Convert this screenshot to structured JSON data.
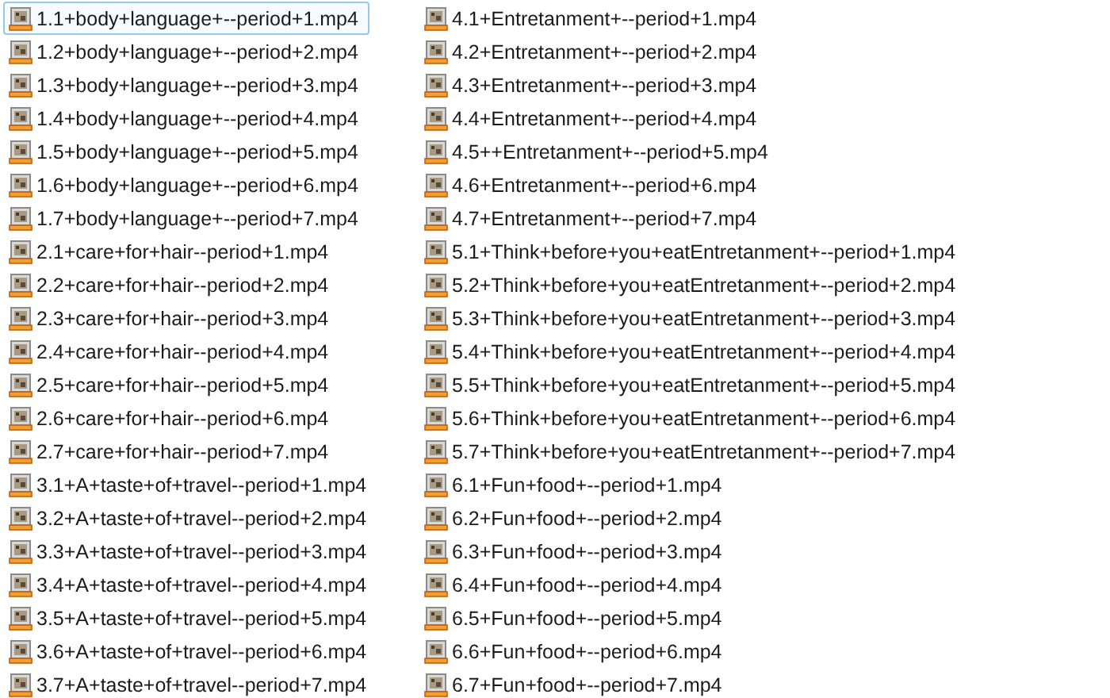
{
  "files": [
    {
      "name": "1.1+body+language+--period+1.mp4",
      "selected": true
    },
    {
      "name": "1.2+body+language+--period+2.mp4",
      "selected": false
    },
    {
      "name": "1.3+body+language+--period+3.mp4",
      "selected": false
    },
    {
      "name": "1.4+body+language+--period+4.mp4",
      "selected": false
    },
    {
      "name": "1.5+body+language+--period+5.mp4",
      "selected": false
    },
    {
      "name": "1.6+body+language+--period+6.mp4",
      "selected": false
    },
    {
      "name": "1.7+body+language+--period+7.mp4",
      "selected": false
    },
    {
      "name": "2.1+care+for+hair--period+1.mp4",
      "selected": false
    },
    {
      "name": "2.2+care+for+hair--period+2.mp4",
      "selected": false
    },
    {
      "name": "2.3+care+for+hair--period+3.mp4",
      "selected": false
    },
    {
      "name": "2.4+care+for+hair--period+4.mp4",
      "selected": false
    },
    {
      "name": "2.5+care+for+hair--period+5.mp4",
      "selected": false
    },
    {
      "name": "2.6+care+for+hair--period+6.mp4",
      "selected": false
    },
    {
      "name": "2.7+care+for+hair--period+7.mp4",
      "selected": false
    },
    {
      "name": "3.1+A+taste+of+travel--period+1.mp4",
      "selected": false
    },
    {
      "name": "3.2+A+taste+of+travel--period+2.mp4",
      "selected": false
    },
    {
      "name": "3.3+A+taste+of+travel--period+3.mp4",
      "selected": false
    },
    {
      "name": "3.4+A+taste+of+travel--period+4.mp4",
      "selected": false
    },
    {
      "name": "3.5+A+taste+of+travel--period+5.mp4",
      "selected": false
    },
    {
      "name": "3.6+A+taste+of+travel--period+6.mp4",
      "selected": false
    },
    {
      "name": "3.7+A+taste+of+travel--period+7.mp4",
      "selected": false
    },
    {
      "name": "4.1+Entretanment+--period+1.mp4",
      "selected": false
    },
    {
      "name": "4.2+Entretanment+--period+2.mp4",
      "selected": false
    },
    {
      "name": "4.3+Entretanment+--period+3.mp4",
      "selected": false
    },
    {
      "name": "4.4+Entretanment+--period+4.mp4",
      "selected": false
    },
    {
      "name": "4.5++Entretanment+--period+5.mp4",
      "selected": false
    },
    {
      "name": "4.6+Entretanment+--period+6.mp4",
      "selected": false
    },
    {
      "name": "4.7+Entretanment+--period+7.mp4",
      "selected": false
    },
    {
      "name": "5.1+Think+before+you+eatEntretanment+--period+1.mp4",
      "selected": false
    },
    {
      "name": "5.2+Think+before+you+eatEntretanment+--period+2.mp4",
      "selected": false
    },
    {
      "name": "5.3+Think+before+you+eatEntretanment+--period+3.mp4",
      "selected": false
    },
    {
      "name": "5.4+Think+before+you+eatEntretanment+--period+4.mp4",
      "selected": false
    },
    {
      "name": "5.5+Think+before+you+eatEntretanment+--period+5.mp4",
      "selected": false
    },
    {
      "name": "5.6+Think+before+you+eatEntretanment+--period+6.mp4",
      "selected": false
    },
    {
      "name": "5.7+Think+before+you+eatEntretanment+--period+7.mp4",
      "selected": false
    },
    {
      "name": "6.1+Fun+food+--period+1.mp4",
      "selected": false
    },
    {
      "name": "6.2+Fun+food+--period+2.mp4",
      "selected": false
    },
    {
      "name": "6.3+Fun+food+--period+3.mp4",
      "selected": false
    },
    {
      "name": "6.4+Fun+food+--period+4.mp4",
      "selected": false
    },
    {
      "name": "6.5+Fun+food+--period+5.mp4",
      "selected": false
    },
    {
      "name": "6.6+Fun+food+--period+6.mp4",
      "selected": false
    },
    {
      "name": "6.7+Fun+food+--period+7.mp4",
      "selected": false
    }
  ]
}
